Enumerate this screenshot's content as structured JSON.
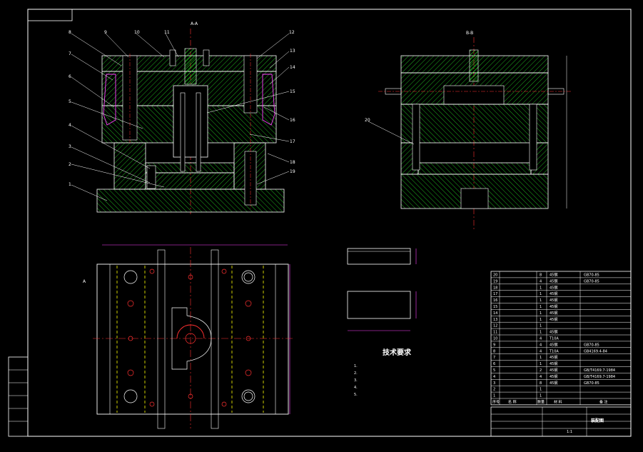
{
  "drawing": {
    "section_a": "A-A",
    "section_b": "B-B",
    "view_arrow": "A",
    "notes_title": "技术要求",
    "notes": [
      "1.",
      "2.",
      "3.",
      "4.",
      "5."
    ],
    "part_numbers_left": [
      "8",
      "7",
      "6",
      "5",
      "4",
      "3",
      "2",
      "1"
    ],
    "part_numbers_top": [
      "9",
      "10",
      "11",
      "12"
    ],
    "part_numbers_right": [
      "13",
      "14",
      "15",
      "16",
      "17",
      "18",
      "19"
    ],
    "part_number_b": "20"
  },
  "bom": {
    "rows": [
      {
        "no": "20",
        "qty": "8",
        "mat": "45钢",
        "note": "GB70-85"
      },
      {
        "no": "19",
        "qty": "4",
        "mat": "45钢",
        "note": "GB70-85"
      },
      {
        "no": "18",
        "qty": "1",
        "mat": "45钢",
        "note": ""
      },
      {
        "no": "17",
        "qty": "1",
        "mat": "45钢",
        "note": ""
      },
      {
        "no": "16",
        "qty": "1",
        "mat": "45钢",
        "note": ""
      },
      {
        "no": "15",
        "qty": "1",
        "mat": "45钢",
        "note": ""
      },
      {
        "no": "14",
        "qty": "1",
        "mat": "45钢",
        "note": ""
      },
      {
        "no": "13",
        "qty": "1",
        "mat": "45钢",
        "note": ""
      },
      {
        "no": "12",
        "qty": "1",
        "mat": "",
        "note": ""
      },
      {
        "no": "11",
        "qty": "1",
        "mat": "45钢",
        "note": ""
      },
      {
        "no": "10",
        "qty": "4",
        "mat": "T10A",
        "note": ""
      },
      {
        "no": "9",
        "qty": "4",
        "mat": "45钢",
        "note": "GB70-85"
      },
      {
        "no": "8",
        "qty": "4",
        "mat": "T10A",
        "note": "GB4169.4-84"
      },
      {
        "no": "7",
        "qty": "1",
        "mat": "45钢",
        "note": ""
      },
      {
        "no": "6",
        "qty": "1",
        "mat": "45钢",
        "note": ""
      },
      {
        "no": "5",
        "qty": "2",
        "mat": "45钢",
        "note": "GB/T4169.7-1984"
      },
      {
        "no": "4",
        "qty": "4",
        "mat": "45钢",
        "note": "GB/T4169.7-1984"
      },
      {
        "no": "3",
        "qty": "8",
        "mat": "45钢",
        "note": "GB70-85"
      },
      {
        "no": "2",
        "qty": "1",
        "mat": "",
        "note": ""
      },
      {
        "no": "1",
        "qty": "1",
        "mat": "",
        "note": ""
      }
    ],
    "header": {
      "no": "序号",
      "name": "名 称",
      "qty": "数量",
      "mat": "材 料",
      "note": "备 注"
    },
    "title": "装配图",
    "scale": "1:1"
  },
  "colors": {
    "frame": "#ffffff",
    "hatch": "#1fae1f",
    "red": "#ff3030",
    "magenta": "#ff40ff",
    "yellow": "#ffff00",
    "cyan": "#00ffff"
  }
}
